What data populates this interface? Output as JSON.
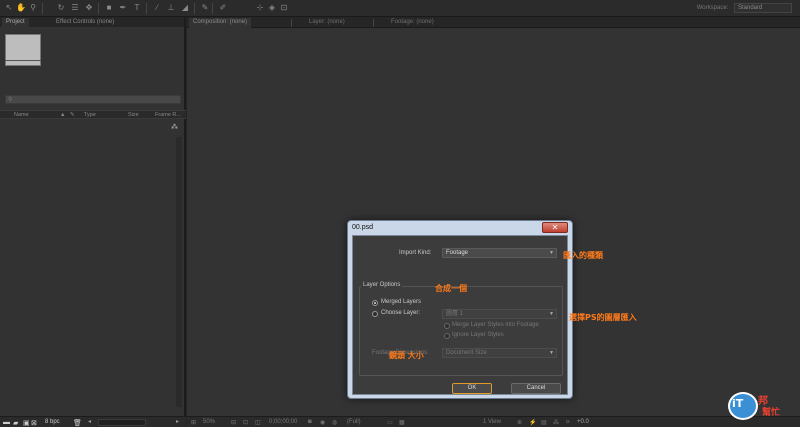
{
  "workspace": {
    "label": "Workspace:",
    "value": "Standard"
  },
  "project_panel": {
    "tabs": [
      "Project",
      "Effect Controls (none)"
    ],
    "columns": [
      "Name",
      "Type",
      "Size",
      "Frame R..."
    ],
    "footer": {
      "bpc": "8 bpc"
    }
  },
  "comp_panel": {
    "tabs": [
      "Composition: (none)",
      "Layer: (none)",
      "Footage: (none)"
    ],
    "footer": {
      "zoom": "50%",
      "timecode": "0;00;00;00",
      "resolution": "(Full)",
      "view": "1 View",
      "exposure": "+0.0"
    }
  },
  "dialog": {
    "title": "00.psd",
    "close": "✕",
    "import_kind_label": "Import Kind:",
    "import_kind_value": "Footage",
    "layer_options_label": "Layer Options",
    "merged_layers": "Merged Layers",
    "choose_layer": "Choose Layer:",
    "choose_layer_value": "圖層 1",
    "merge_styles": "Merge Layer Styles into Footage",
    "ignore_styles": "Ignore Layer Styles",
    "footage_dimensions_label": "Footage Dimensions:",
    "footage_dimensions_value": "Document Size",
    "ok": "OK",
    "cancel": "Cancel"
  },
  "annotations": {
    "import_kind": "匯入的種類",
    "merged": "合成一個",
    "choose_layer": "選擇PS的圖層匯入",
    "size": "鏡頭 大小"
  },
  "watermark": {
    "it": "iT",
    "bang": "邦",
    "help": "幫忙"
  },
  "colors": {
    "accent": "#ff7a1a",
    "ok_border": "#e09a2a",
    "dialog_frame": "#c9d7e8"
  }
}
